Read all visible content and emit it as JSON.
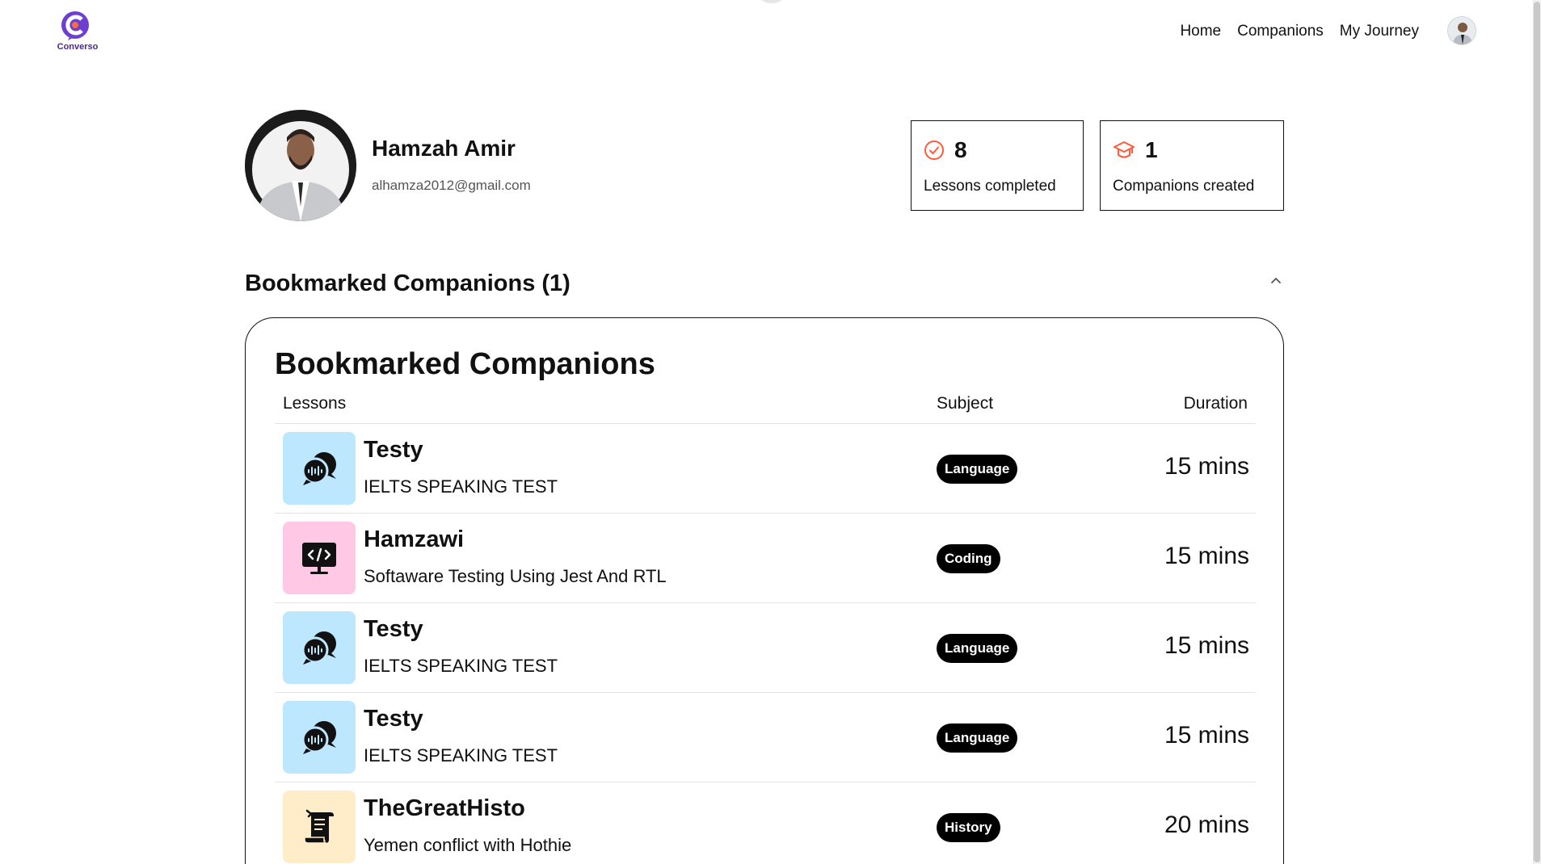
{
  "brand": {
    "name": "Converso",
    "color": "#6c3fd1",
    "accent": "#ff6a3d"
  },
  "nav": {
    "items": [
      "Home",
      "Companions",
      "My Journey"
    ]
  },
  "profile": {
    "name": "Hamzah Amir",
    "email": "alhamza2012@gmail.com"
  },
  "stats": {
    "lessons": {
      "value": "8",
      "label": "Lessons completed",
      "icon": "check-circle-icon"
    },
    "companions": {
      "value": "1",
      "label": "Companions created",
      "icon": "graduation-cap-icon"
    }
  },
  "section": {
    "title": "Bookmarked Companions (1)"
  },
  "card": {
    "title": "Bookmarked Companions",
    "columns": {
      "lessons": "Lessons",
      "subject": "Subject",
      "duration": "Duration"
    },
    "rows": [
      {
        "title": "Testy",
        "topic": "IELTS SPEAKING TEST",
        "subject": "Language",
        "duration": "15 mins",
        "color": "#bde7ff",
        "icon": "speech-bubbles-icon"
      },
      {
        "title": "Hamzawi",
        "topic": "Softaware Testing Using Jest And RTL",
        "subject": "Coding",
        "duration": "15 mins",
        "color": "#ffc8e4",
        "icon": "code-monitor-icon"
      },
      {
        "title": "Testy",
        "topic": "IELTS SPEAKING TEST",
        "subject": "Language",
        "duration": "15 mins",
        "color": "#bde7ff",
        "icon": "speech-bubbles-icon"
      },
      {
        "title": "Testy",
        "topic": "IELTS SPEAKING TEST",
        "subject": "Language",
        "duration": "15 mins",
        "color": "#bde7ff",
        "icon": "speech-bubbles-icon"
      },
      {
        "title": "TheGreatHisto",
        "topic": "Yemen conflict with Hothie",
        "subject": "History",
        "duration": "20 mins",
        "color": "#ffecc8",
        "icon": "scroll-icon"
      }
    ]
  }
}
